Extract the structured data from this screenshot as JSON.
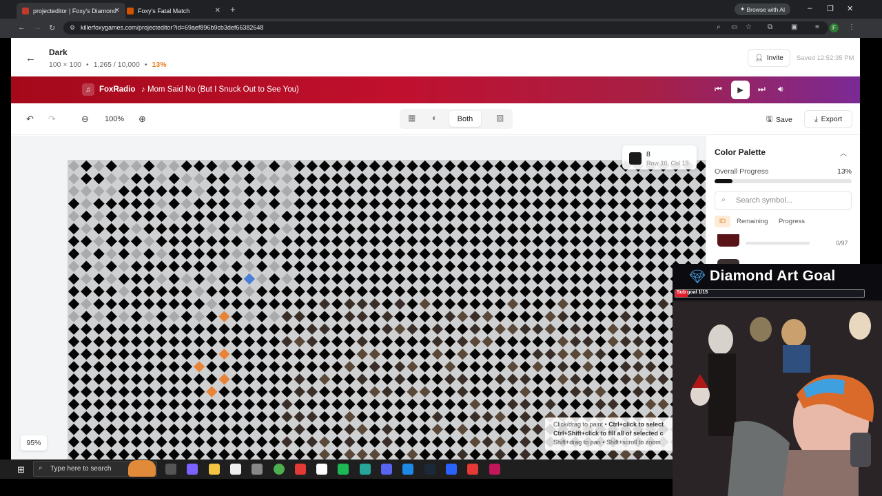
{
  "browser": {
    "tabs": [
      {
        "title": "projecteditor | Foxy's Diamond",
        "active": true,
        "favicon_color": "#c0392b"
      },
      {
        "title": "Foxy's Fatal Match",
        "active": false,
        "favicon_color": "#d35400"
      }
    ],
    "new_tab_icon": "plus-icon",
    "browse_ai_label": "Browse with AI",
    "url": "killerfoxygames.com/projecteditor?id=69aef896b9cb3def66382648"
  },
  "header": {
    "title": "Dark",
    "dimensions": "100 × 100",
    "count": "1,265 / 10,000",
    "separator": "•",
    "percent": "13%",
    "invite_label": "Invite",
    "saved_text": "Saved 12:52:35 PM"
  },
  "radio": {
    "station": "FoxRadio",
    "song": "♪ Mom Said No (But I Snuck Out to See You)"
  },
  "toolbar": {
    "zoom": "100%",
    "view_both": "Both",
    "save_label": "Save",
    "export_label": "Export"
  },
  "tooltip": {
    "symbol": "8",
    "position": "Row 10, Col 15",
    "swatch_color": "#1a1a1a"
  },
  "help": {
    "line1_a": "Click/drag to paint • ",
    "line1_b": "Ctrl+click to select",
    "line2": "Ctrl+Shift+click to fill all of selected c",
    "line3": "Shift+drag to pan • Shift+scroll to zoom"
  },
  "zoom_badge": "95%",
  "palette": {
    "title": "Color Palette",
    "overall_label": "Overall Progress",
    "overall_value": "13%",
    "overall_fraction": 0.13,
    "search_placeholder": "Search symbol...",
    "sort_tabs": [
      "ID",
      "Remaining",
      "Progress"
    ],
    "items": [
      {
        "color": "#5a1419",
        "count": "0/97"
      }
    ]
  },
  "overlay": {
    "goal_title": "Diamond Art Goal",
    "sub_goal": "Sub goal 1/15",
    "sub_goal_fraction": 0.0667
  },
  "taskbar": {
    "search_placeholder": "Type here to search",
    "apps": [
      "task-view",
      "copilot",
      "file-explorer",
      "notepad",
      "app",
      "chrome",
      "app",
      "obs",
      "spotify",
      "app",
      "discord",
      "app",
      "steam",
      "app",
      "app",
      "app"
    ]
  }
}
